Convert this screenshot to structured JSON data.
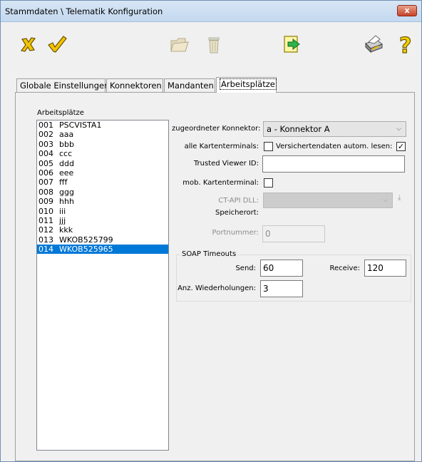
{
  "window": {
    "title": "Stammdaten \\ Telematik Konfiguration",
    "close_label": "x"
  },
  "toolbar": {
    "buttons": [
      {
        "name": "cancel",
        "icon": "x-cancel-icon"
      },
      {
        "name": "confirm",
        "icon": "checkmark-icon"
      },
      {
        "name": "open-folder",
        "icon": "folder-icon"
      },
      {
        "name": "delete",
        "icon": "trash-icon"
      },
      {
        "name": "exit",
        "icon": "exit-arrow-icon"
      },
      {
        "name": "print",
        "icon": "printer-icon"
      },
      {
        "name": "help",
        "icon": "help-icon"
      }
    ]
  },
  "tabs": [
    {
      "label": "Globale Einstellungen"
    },
    {
      "label": "Konnektoren"
    },
    {
      "label": "Mandanten"
    },
    {
      "label": "Arbeitsplätze",
      "active": true
    }
  ],
  "workstations": {
    "label": "Arbeitsplätze",
    "items": [
      {
        "num": "001",
        "name": "PSCVISTA1"
      },
      {
        "num": "002",
        "name": "aaa"
      },
      {
        "num": "003",
        "name": "bbb"
      },
      {
        "num": "004",
        "name": "ccc"
      },
      {
        "num": "005",
        "name": "ddd"
      },
      {
        "num": "006",
        "name": "eee"
      },
      {
        "num": "007",
        "name": "fff"
      },
      {
        "num": "008",
        "name": "ggg"
      },
      {
        "num": "009",
        "name": "hhh"
      },
      {
        "num": "010",
        "name": "iii"
      },
      {
        "num": "011",
        "name": "jjj"
      },
      {
        "num": "012",
        "name": "kkk"
      },
      {
        "num": "013",
        "name": "WKOB525799"
      },
      {
        "num": "014",
        "name": "WKOB525965",
        "selected": true
      }
    ]
  },
  "form": {
    "konnektor_label": "zugeordneter Konnektor:",
    "konnektor_value": "a - Konnektor A",
    "alle_kartenterminals_label": "alle Kartenterminals:",
    "alle_kartenterminals_checked": false,
    "versichertendaten_label": "Versichertendaten autom. lesen:",
    "versichertendaten_checked": true,
    "trusted_viewer_label": "Trusted Viewer ID:",
    "trusted_viewer_value": "",
    "mob_kartenterminal_label": "mob. Kartenterminal:",
    "mob_kartenterminal_checked": false,
    "ctapi_label": "CT-API DLL:",
    "ctapi_value": "",
    "speicherort_label": "Speicherort:",
    "portnummer_label": "Portnummer:",
    "portnummer_value": "0"
  },
  "soap": {
    "title": "SOAP Timeouts",
    "send_label": "Send:",
    "send_value": "60",
    "receive_label": "Receive:",
    "receive_value": "120",
    "retries_label": "Anz. Wiederholungen:",
    "retries_value": "3"
  },
  "colors": {
    "selection": "#0078d7",
    "cancel_icon": "#f2c400",
    "exit_icon": "#2fb34a",
    "help_icon": "#f5d000"
  }
}
